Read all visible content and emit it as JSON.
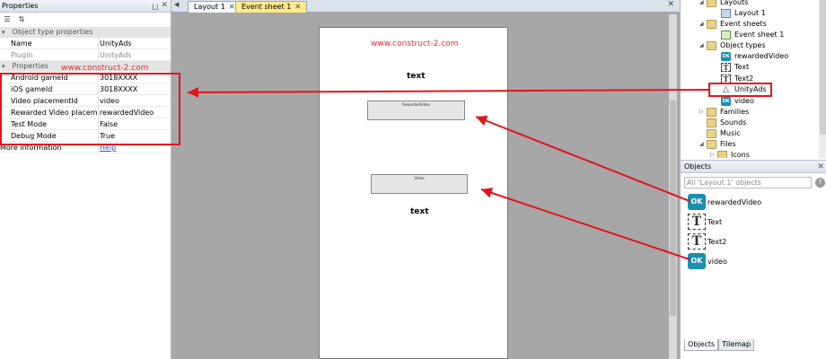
{
  "properties_panel": {
    "title": "Properties",
    "pin_glyph": "⨆",
    "close_glyph": "✕",
    "toolbar": {
      "categorized_glyph": "☰",
      "sort_glyph": "⇅"
    },
    "section_object_type": {
      "label": "Object type properties",
      "toggle": "▾"
    },
    "object_type_rows": [
      {
        "key": "Name",
        "value": "UnityAds"
      },
      {
        "key": "Plugin",
        "value": "UnityAds"
      }
    ],
    "section_properties": {
      "label": "Properties",
      "toggle": "▾"
    },
    "property_rows": [
      {
        "key": "Android gameId",
        "value": "3018XXXX"
      },
      {
        "key": "iOS gameId",
        "value": "3018XXXX"
      },
      {
        "key": "Video placementId",
        "value": "video"
      },
      {
        "key": "Rewarded Video placem...",
        "value": "rewardedVideo"
      },
      {
        "key": "Test Mode",
        "value": "False"
      },
      {
        "key": "Debug Mode",
        "value": "True"
      }
    ],
    "more_info": {
      "key": "More information",
      "value": "Help"
    },
    "watermark": "www.construct-2.com"
  },
  "editor": {
    "tabs": [
      {
        "label": "Layout 1",
        "close": "✕"
      },
      {
        "label": "Event sheet 1",
        "close": "✕"
      }
    ],
    "tabs_close_glyph": "✕",
    "tabs_arrow_glyph": "◀",
    "layout": {
      "watermark": "www.construct-2.com",
      "text1": "text",
      "text2": "text",
      "button1": "RewardedVideo",
      "button2": "Video"
    }
  },
  "project_tree": {
    "nodes": [
      {
        "label": "Layouts",
        "icon": "folder-icon",
        "arrow": "◢"
      },
      {
        "label": "Layout 1",
        "icon": "layout-icon"
      },
      {
        "label": "Event sheets",
        "icon": "folder-icon",
        "arrow": "◢"
      },
      {
        "label": "Event sheet 1",
        "icon": "event-sheet-icon"
      },
      {
        "label": "Object types",
        "icon": "folder-icon",
        "arrow": "◢"
      },
      {
        "label": "rewardedVideo",
        "icon": "ok-button-icon"
      },
      {
        "label": "Text",
        "icon": "text-icon"
      },
      {
        "label": "Text2",
        "icon": "text-icon"
      },
      {
        "label": "UnityAds",
        "icon": "unity-icon"
      },
      {
        "label": "video",
        "icon": "ok-button-icon"
      },
      {
        "label": "Families",
        "icon": "folder-icon",
        "arrow": "▷"
      },
      {
        "label": "Sounds",
        "icon": "folder-icon"
      },
      {
        "label": "Music",
        "icon": "folder-icon"
      },
      {
        "label": "Files",
        "icon": "folder-icon",
        "arrow": "◢"
      },
      {
        "label": "Icons",
        "icon": "folder-icon",
        "arrow": "▷"
      }
    ]
  },
  "objects_panel": {
    "title": "Objects",
    "close_glyph": "✕",
    "filter_placeholder": "All 'Layout 1' objects",
    "filter_button": "↑",
    "items": [
      {
        "label": "rewardedVideo",
        "icon": "ok-button-icon",
        "glyph": "OK"
      },
      {
        "label": "Text",
        "icon": "text-icon",
        "glyph": "T"
      },
      {
        "label": "Text2",
        "icon": "text-icon",
        "glyph": "T"
      },
      {
        "label": "video",
        "icon": "ok-button-icon",
        "glyph": "OK"
      }
    ],
    "bottom_tabs": [
      "Objects",
      "Tilemap"
    ]
  },
  "colors": {
    "annotation_red": "#e0161b",
    "watermark_red": "#e03030",
    "canvas_grey": "#a7a7a7",
    "ok_icon_blue": "#1a8fb0"
  }
}
